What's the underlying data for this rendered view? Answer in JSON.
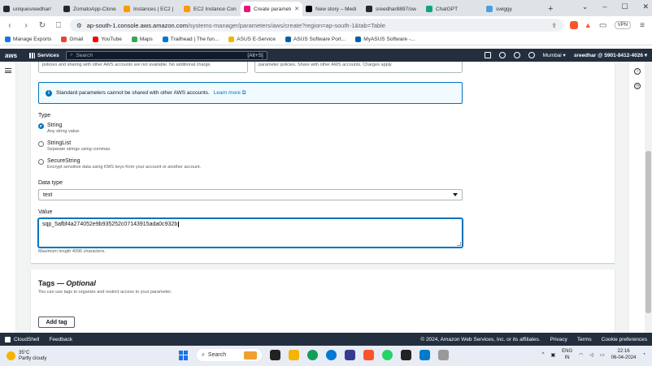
{
  "browser": {
    "tabs": [
      {
        "title": "uniquesreedhar/",
        "color": "#24292f"
      },
      {
        "title": "ZomatoApp-Clone",
        "color": "#24292f"
      },
      {
        "title": "Instances | EC2 |",
        "color": "#ff9900"
      },
      {
        "title": "EC2 Instance Con",
        "color": "#ff9900"
      },
      {
        "title": "Create paramete",
        "color": "#e7157b",
        "active": true
      },
      {
        "title": "New story – Medi",
        "color": "#000000"
      },
      {
        "title": "sreedhar8897/sw",
        "color": "#24292f"
      },
      {
        "title": "ChatGPT",
        "color": "#10a37f"
      },
      {
        "title": "swiggy",
        "color": "#4b9fe1"
      }
    ],
    "new_tab": "+",
    "window_controls": [
      "⌄",
      "–",
      "☐",
      "✕"
    ],
    "url_host": "ap-south-1.console.aws.amazon.com",
    "url_path": "/systems-manager/parameters/aws/create?region=ap-south-1&tab=Table",
    "vpn_label": "VPN",
    "bookmarks": [
      {
        "label": "Manage Exports",
        "color": "#1a73e8"
      },
      {
        "label": "Gmail",
        "color": "#ea4335"
      },
      {
        "label": "YouTube",
        "color": "#ff0000"
      },
      {
        "label": "Maps",
        "color": "#34a853"
      },
      {
        "label": "Trailhead | The fun...",
        "color": "#0176d3"
      },
      {
        "label": "ASUS E-Service",
        "color": "#f4b400"
      },
      {
        "label": "ASUS Software Port...",
        "color": "#0060a9"
      },
      {
        "label": "MyASUS Software -...",
        "color": "#0060a9"
      }
    ]
  },
  "aws_nav": {
    "logo": "aws",
    "services": "Services",
    "search_placeholder": "Search",
    "search_shortcut": "[Alt+S]",
    "region": "Mumbai ▾",
    "account": "sreedhar @ 5901-8412-4026 ▾"
  },
  "form": {
    "tier_left_text": "policies and sharing with other AWS accounts are not available. No additional charge.",
    "tier_right_text": "parameter policies. Share with other AWS accounts. Charges apply.",
    "info_text": "Standard parameters cannot be shared with other AWS accounts.",
    "info_link": "Learn more",
    "type_label": "Type",
    "types": [
      {
        "title": "String",
        "desc": "Any string value.",
        "selected": true
      },
      {
        "title": "StringList",
        "desc": "Separate strings using commas.",
        "selected": false
      },
      {
        "title": "SecureString",
        "desc": "Encrypt sensitive data using KMS keys from your account or another account.",
        "selected": false
      }
    ],
    "data_type_label": "Data type",
    "data_type_value": "text",
    "value_label": "Value",
    "value": "sqp_5afbf4a274052e9b935252c07143915ada0c932b",
    "value_hint": "Maximum length 4096 characters."
  },
  "tags": {
    "title": "Tags — ",
    "title_optional": "Optional",
    "desc": "You can use tags to organize and restrict access to your parameter.",
    "add_button": "Add tag"
  },
  "aws_footer": {
    "cloudshell": "CloudShell",
    "feedback": "Feedback",
    "copyright": "© 2024, Amazon Web Services, Inc. or its affiliates.",
    "privacy": "Privacy",
    "terms": "Terms",
    "cookies": "Cookie preferences"
  },
  "taskbar": {
    "temp": "35°C",
    "weather": "Partly cloudy",
    "search": "Search",
    "lang_top": "ENG",
    "lang_bottom": "IN",
    "time": "22:16",
    "date": "06-04-2024"
  }
}
